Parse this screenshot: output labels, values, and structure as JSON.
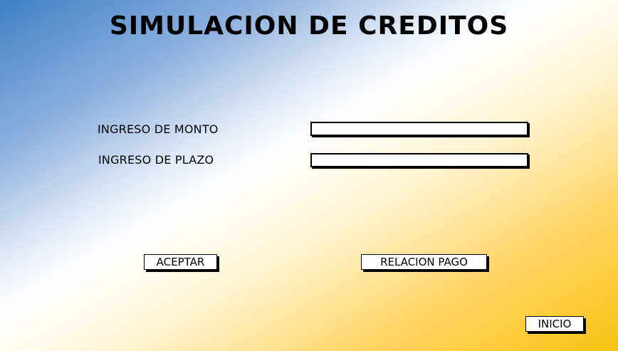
{
  "header": {
    "title": "SIMULACION DE CREDITOS"
  },
  "form": {
    "monto_label": "INGRESO DE MONTO",
    "monto_value": "",
    "monto_placeholder": "",
    "plazo_label": "INGRESO DE PLAZO",
    "plazo_value": "",
    "plazo_placeholder": ""
  },
  "actions": {
    "aceptar_label": "ACEPTAR",
    "relacion_pago_label": "RELACION PAGO",
    "inicio_label": "INICIO"
  },
  "colors": {
    "gradient_blue": "#3f7fc6",
    "gradient_white": "#ffffff",
    "gradient_yellow": "#f7c20f"
  }
}
